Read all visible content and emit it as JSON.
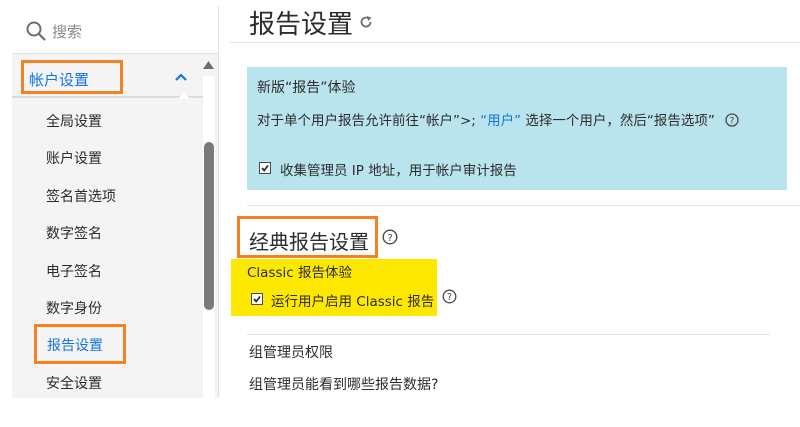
{
  "sidebar": {
    "search_placeholder": "搜索",
    "section_label": "帐户设置",
    "items": [
      {
        "label": "全局设置"
      },
      {
        "label": "账户设置"
      },
      {
        "label": "签名首选项"
      },
      {
        "label": "数字签名"
      },
      {
        "label": "电子签名"
      },
      {
        "label": "数字身份"
      },
      {
        "label": "报告设置",
        "selected": true
      },
      {
        "label": "安全设置"
      }
    ]
  },
  "page": {
    "title": "报告设置",
    "icon": "refresh-icon"
  },
  "new_experience": {
    "title": "新版“报告”体验",
    "desc_before": "对于单个用户报告允许前往“帐户”>; ",
    "desc_link": "“用户”",
    "desc_after": " 选择一个用户，然后“报告选项”",
    "checkbox_label": "收集管理员 IP 地址，用于帐户审计报告",
    "checkbox_checked": true,
    "background": "#b9e4ee"
  },
  "classic": {
    "heading": "经典报告设置",
    "subtitle": "Classic 报告体验",
    "checkbox_label": "运行用户启用 Classic 报告",
    "checkbox_checked": true,
    "highlight_color": "#ffe800"
  },
  "group_admin": {
    "title": "组管理员权限",
    "question": "组管理员能看到哪些报告数据?"
  },
  "colors": {
    "accent": "#1473e6",
    "annotation": "#f58220"
  }
}
